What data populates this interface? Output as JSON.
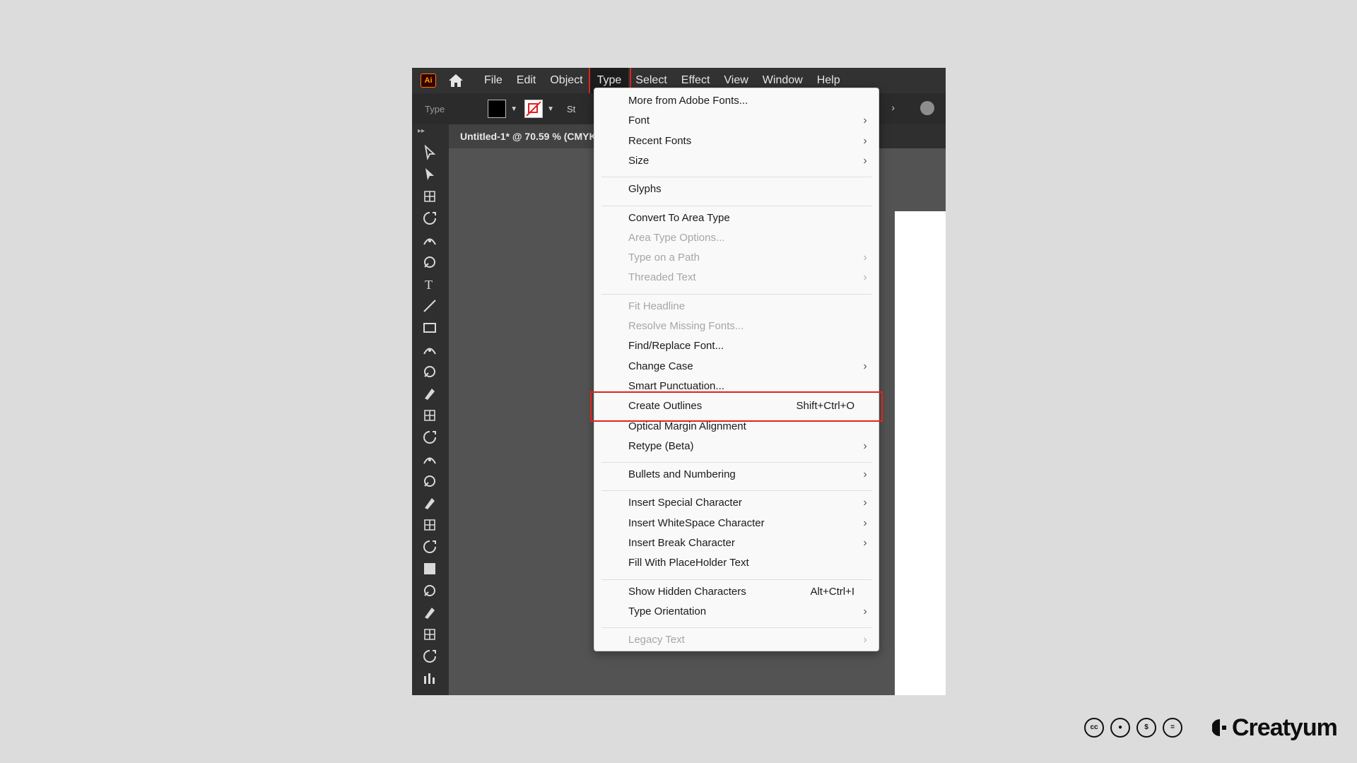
{
  "app": {
    "logo_text": "Ai",
    "menus": [
      "File",
      "Edit",
      "Object",
      "Type",
      "Select",
      "Effect",
      "View",
      "Window",
      "Help"
    ],
    "active_menu": "Type"
  },
  "control_bar": {
    "label": "Type",
    "stroke_label": "St"
  },
  "document_tab": {
    "title": "Untitled-1* @ 70.59 % (CMYK"
  },
  "type_menu": {
    "items": [
      {
        "label": "More from Adobe Fonts...",
        "enabled": true,
        "submenu": false,
        "shortcut": ""
      },
      {
        "label": "Font",
        "enabled": true,
        "submenu": true,
        "shortcut": ""
      },
      {
        "label": "Recent Fonts",
        "enabled": true,
        "submenu": true,
        "shortcut": ""
      },
      {
        "label": "Size",
        "enabled": true,
        "submenu": true,
        "shortcut": ""
      },
      {
        "label": "Glyphs",
        "enabled": true,
        "submenu": false,
        "shortcut": ""
      },
      {
        "label": "Convert To Area Type",
        "enabled": true,
        "submenu": false,
        "shortcut": ""
      },
      {
        "label": "Area Type Options...",
        "enabled": false,
        "submenu": false,
        "shortcut": ""
      },
      {
        "label": "Type on a Path",
        "enabled": false,
        "submenu": true,
        "shortcut": ""
      },
      {
        "label": "Threaded Text",
        "enabled": false,
        "submenu": true,
        "shortcut": ""
      },
      {
        "label": "Fit Headline",
        "enabled": false,
        "submenu": false,
        "shortcut": ""
      },
      {
        "label": "Resolve Missing Fonts...",
        "enabled": false,
        "submenu": false,
        "shortcut": ""
      },
      {
        "label": "Find/Replace Font...",
        "enabled": true,
        "submenu": false,
        "shortcut": ""
      },
      {
        "label": "Change Case",
        "enabled": true,
        "submenu": true,
        "shortcut": ""
      },
      {
        "label": "Smart Punctuation...",
        "enabled": true,
        "submenu": false,
        "shortcut": ""
      },
      {
        "label": "Create Outlines",
        "enabled": true,
        "submenu": false,
        "shortcut": "Shift+Ctrl+O",
        "highlighted": true
      },
      {
        "label": "Optical Margin Alignment",
        "enabled": true,
        "submenu": false,
        "shortcut": ""
      },
      {
        "label": "Retype (Beta)",
        "enabled": true,
        "submenu": true,
        "shortcut": ""
      },
      {
        "label": "Bullets and Numbering",
        "enabled": true,
        "submenu": true,
        "shortcut": ""
      },
      {
        "label": "Insert Special Character",
        "enabled": true,
        "submenu": true,
        "shortcut": ""
      },
      {
        "label": "Insert WhiteSpace Character",
        "enabled": true,
        "submenu": true,
        "shortcut": ""
      },
      {
        "label": "Insert Break Character",
        "enabled": true,
        "submenu": true,
        "shortcut": ""
      },
      {
        "label": "Fill With PlaceHolder Text",
        "enabled": true,
        "submenu": false,
        "shortcut": ""
      },
      {
        "label": "Show Hidden Characters",
        "enabled": true,
        "submenu": false,
        "shortcut": "Alt+Ctrl+I"
      },
      {
        "label": "Type Orientation",
        "enabled": true,
        "submenu": true,
        "shortcut": ""
      },
      {
        "label": "Legacy Text",
        "enabled": false,
        "submenu": true,
        "shortcut": ""
      }
    ]
  },
  "footer": {
    "brand": "Creatyum"
  },
  "colors": {
    "highlight_border": "#e0241c",
    "menubar_bg": "#323232",
    "menu_bg": "#f9f9f9"
  }
}
